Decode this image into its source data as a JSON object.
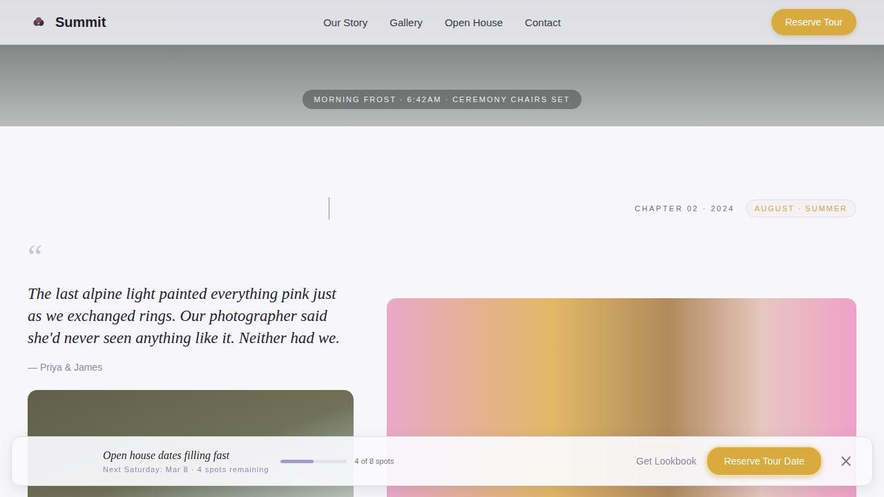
{
  "brand": {
    "name": "Summit"
  },
  "nav": {
    "links": [
      "Our Story",
      "Gallery",
      "Open House",
      "Contact"
    ],
    "cta": "Reserve Tour"
  },
  "hero": {
    "caption": "MORNING FROST · 6:42AM · CEREMONY CHAIRS SET"
  },
  "story": {
    "chapter": "CHAPTER 02 · 2024",
    "season": "AUGUST · SUMMER",
    "quote_mark": "“",
    "quote": "The last alpine light painted everything pink just as we exchanged rings. Our photographer said she'd never seen anything like it. Neither had we.",
    "attribution": "— Priya & James"
  },
  "banner": {
    "title": "Open house dates filling fast",
    "subtitle": "Next Saturday: Mar 8 · 4 spots remaining",
    "progress": {
      "level": 0.5,
      "reading": "4 of 8 spots"
    },
    "link": "Get Lookbook",
    "cta": "Reserve Tour Date",
    "close": "×"
  }
}
